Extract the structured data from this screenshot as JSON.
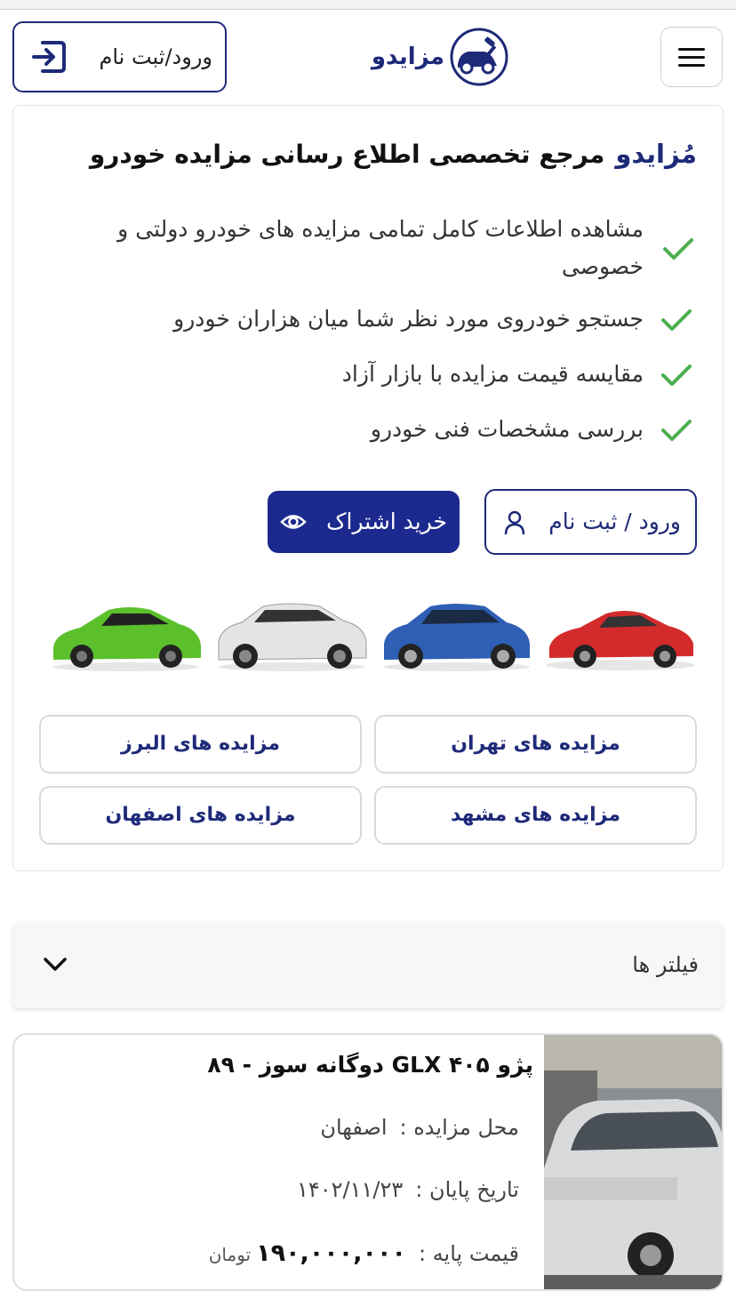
{
  "header": {
    "logo_text": "مزایدو",
    "login_label": "ورود/ثبت نام",
    "menu_icon": "hamburger-icon",
    "login_icon": "sign-in-icon"
  },
  "hero": {
    "brand": "مُزایدو",
    "tagline": "مرجع تخصصی اطلاع رسانی مزایده خودرو",
    "features": [
      "مشاهده اطلاعات کامل تمامی مزایده های خودرو دولتی و خصوصی",
      "جستجو خودروی مورد نظر شما میان هزاران خودرو",
      "مقایسه قیمت مزایده با بازار آزاد",
      "بررسی مشخصات فنی خودرو"
    ],
    "login_button": "ورود / ثبت نام",
    "subscribe_button": "خرید اشتراک",
    "cities": [
      "مزایده های تهران",
      "مزایده های البرز",
      "مزایده های مشهد",
      "مزایده های اصفهان"
    ]
  },
  "filters": {
    "label": "فیلتر ها"
  },
  "listing": {
    "title": "پژو GLX ۴۰۵ دوگانه سوز - ۸۹",
    "location_label": "محل مزایده :",
    "location": "اصفهان",
    "end_date_label": "تاریخ پایان :",
    "end_date": "۱۴۰۲/۱۱/۲۳",
    "base_price_label": "قیمت پایه :",
    "base_price": "۱۹۰,۰۰۰,۰۰۰",
    "currency": "تومان"
  },
  "colors": {
    "brand": "#1e2a78",
    "primary_button": "#1c2a8f",
    "check": "#4caf50"
  }
}
